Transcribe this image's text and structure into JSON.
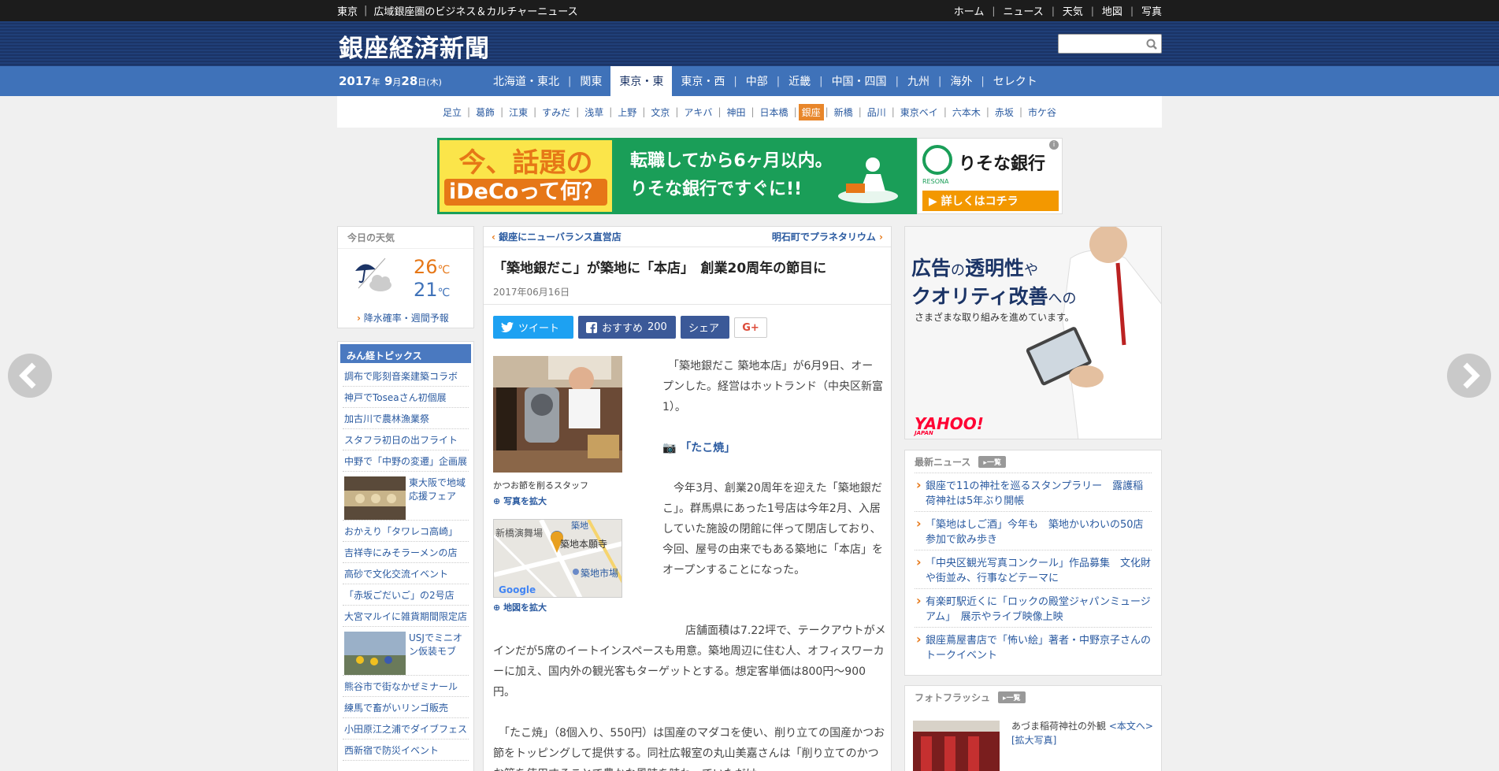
{
  "topbar": {
    "region": "東京",
    "tagline": "広域銀座圏のビジネス＆カルチャーニュース",
    "links": [
      "ホーム",
      "ニュース",
      "天気",
      "地図",
      "写真"
    ]
  },
  "header": {
    "site_name": "銀座経済新聞",
    "search_placeholder": ""
  },
  "nav": {
    "date_year": "2017",
    "year_unit": "年",
    "date_month": "9",
    "month_unit": "月",
    "date_day": "28",
    "day_unit": "日",
    "weekday": "(木)",
    "regions": [
      "北海道・東北",
      "関東",
      "東京・東",
      "東京・西",
      "中部",
      "近畿",
      "中国・四国",
      "九州",
      "海外",
      "セレクト"
    ],
    "active_region": "東京・東"
  },
  "subnav": {
    "areas": [
      "足立",
      "葛飾",
      "江東",
      "すみだ",
      "浅草",
      "上野",
      "文京",
      "アキバ",
      "神田",
      "日本橋",
      "銀座",
      "新橋",
      "品川",
      "東京ベイ",
      "六本木",
      "赤坂",
      "市ケ谷"
    ],
    "active_area": "銀座"
  },
  "banner": {
    "left_line1": "今、話題の",
    "left_line2": "iDeCoって何？",
    "mid_line1": "転職してから6ヶ月以内。",
    "mid_line2": "りそな銀行ですぐに!!",
    "bank_name": "りそな銀行",
    "bank_sub": "RESONA",
    "cta": "▶ 詳しくはコチラ",
    "info": "i",
    "colors": {
      "green": "#1a9e58",
      "yellow": "#fbe54a",
      "orange": "#e67717"
    }
  },
  "weather": {
    "heading": "今日の天気",
    "high": "26",
    "low": "21",
    "unit": "℃",
    "more": "降水確率・週間予報",
    "icon": "umbrella-cloud-icon"
  },
  "topics": {
    "heading": "みん経トピックス",
    "items": [
      {
        "text": "調布で彫刻音楽建築コラボ"
      },
      {
        "text": "神戸でToseaさん初個展"
      },
      {
        "text": "加古川で農林漁業祭"
      },
      {
        "text": "スタフラ初日の出フライト"
      },
      {
        "text": "中野で「中野の変遷」企画展"
      },
      {
        "text": "東大阪で地域応援フェア",
        "thumb": true
      },
      {
        "text": "おかえり「タワレコ高崎」"
      },
      {
        "text": "吉祥寺にみそラーメンの店"
      },
      {
        "text": "高砂で文化交流イベント"
      },
      {
        "text": "「赤坂ごだいご」の2号店"
      },
      {
        "text": "大宮マルイに雑貨期間限定店"
      },
      {
        "text": "USJでミニオン仮装モブ",
        "thumb": true
      },
      {
        "text": "熊谷市で街なかぜミナール"
      },
      {
        "text": "練馬で畜がいリンゴ販売"
      },
      {
        "text": "小田原江之浦でダイブフェス"
      },
      {
        "text": "西新宿で防災イベント"
      }
    ]
  },
  "article": {
    "prev_link": "銀座にニューバランス直営店",
    "next_link": "明石町でプラネタリウム",
    "title": "「築地銀だこ」が築地に「本店」　創業20周年の節目に",
    "date": "2017年06月16日",
    "social": {
      "tweet": "ツイート",
      "recommend": "おすすめ",
      "recommend_count": "200",
      "share": "シェア",
      "gplus": "G+"
    },
    "fig1_caption": "かつお節を削るスタッフ",
    "fig1_zoom": "写真を拡大",
    "fig2_zoom": "地図を拡大",
    "map_labels": {
      "l1": "新橋演舞場",
      "l2": "築地",
      "l3": "築地本願寺",
      "l4": "築地市場",
      "l5": "Google"
    },
    "p1": "　「築地銀だこ 築地本店」が6月9日、オープンした。経営はホットランド（中央区新富1）。",
    "photo_link": "「たこ焼」",
    "p2": "　今年3月、創業20周年を迎えた「築地銀だこ」。群馬県にあった1号店は今年2月、入居していた施設の閉館に伴って閉店しており、今回、屋号の由来でもある築地に「本店」をオープンすることになった。",
    "p3": "　店舗面積は7.22坪で、テークアウトがメインだが5席のイートインスペースも用意。築地周辺に住む人、オフィスワーカーに加え、国内外の観光客もターゲットとする。想定客単価は800円～900円。",
    "p4": "　「たこ焼」（8個入り、550円）は国産のマダコを使い、削り立ての国産かつお節をトッピングして提供する。同社広報室の丸山美嘉さんは「削り立てのかつお節を使用することで豊かな風味を味わっていただけ"
  },
  "ad_right": {
    "line1a": "広告",
    "line1b": "の",
    "line1c": "透明性",
    "line1d": "や",
    "line2a": "クオリティ改善",
    "line2b": "への",
    "line3": "さまざまな取り組みを進めています。",
    "brand": "YAHOO!",
    "brand_sub": "JAPAN"
  },
  "latest": {
    "heading": "最新ニュース",
    "list_label": "一覧",
    "items": [
      "銀座で11の神社を巡るスタンプラリー　露護稲荷神社は5年ぶり開帳",
      "「築地はしご酒」今年も　築地かいわいの50店参加で飲み歩き",
      "「中央区観光写真コンクール」作品募集　文化財や街並み、行事などテーマに",
      "有楽町駅近くに「ロックの殿堂ジャパンミュージアム」　展示やライブ映像上映",
      "銀座蔦屋書店で「怖い絵」著者・中野京子さんのトークイベント"
    ]
  },
  "photo_flash": {
    "heading": "フォトフラッシュ",
    "list_label": "一覧",
    "caption": "あづま稲荷神社の外観",
    "link": "<本文へ>",
    "zoom": "[拡大写真]"
  }
}
